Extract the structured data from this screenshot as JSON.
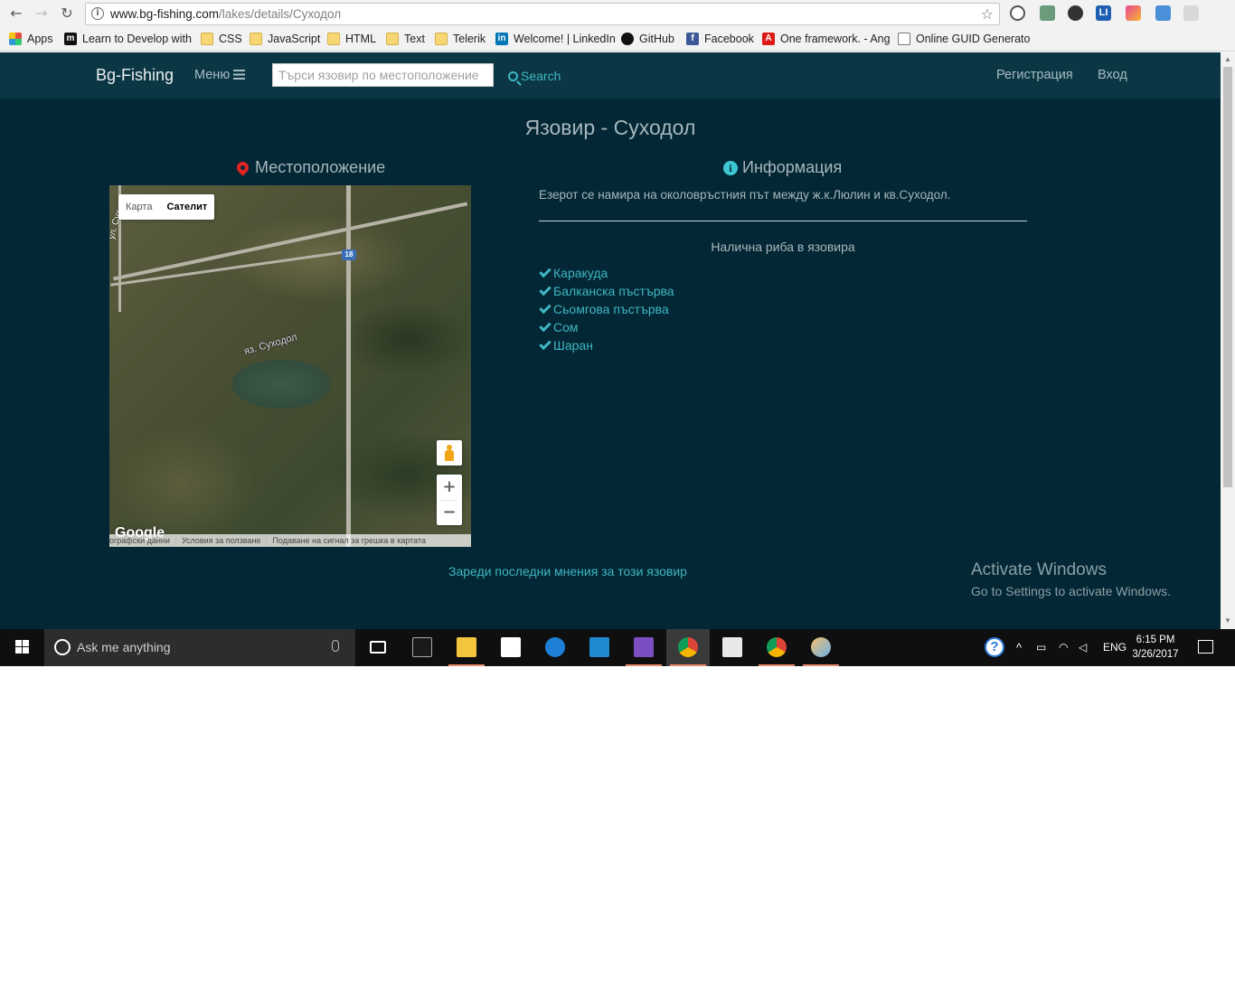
{
  "browser": {
    "url_host": "www.bg-fishing.com",
    "url_path": "/lakes/details/Суходол",
    "bookmarks": [
      {
        "label": "Apps",
        "icon": "apps-grid-icon"
      },
      {
        "label": "Learn to Develop with",
        "icon": "m-icon"
      },
      {
        "label": "CSS",
        "icon": "folder-icon"
      },
      {
        "label": "JavaScript",
        "icon": "folder-icon"
      },
      {
        "label": "HTML",
        "icon": "folder-icon"
      },
      {
        "label": "Text",
        "icon": "folder-icon"
      },
      {
        "label": "Telerik",
        "icon": "folder-icon"
      },
      {
        "label": "Welcome! | LinkedIn",
        "icon": "linkedin-icon"
      },
      {
        "label": "GitHub",
        "icon": "github-icon"
      },
      {
        "label": "Facebook",
        "icon": "facebook-icon"
      },
      {
        "label": "One framework. - Ang",
        "icon": "angular-icon"
      },
      {
        "label": "Online GUID Generato",
        "icon": "page-icon"
      }
    ]
  },
  "navbar": {
    "brand": "Bg-Fishing",
    "menu": "Меню",
    "search_placeholder": "Търси язовир по местоположение",
    "search_button": "Search",
    "register": "Регистрация",
    "login": "Вход"
  },
  "page": {
    "title": "Язовир - Суходол",
    "location_heading": "Местоположение",
    "info_heading": "Информация",
    "info_text": "Езерот се намира на околовръстния път между ж.к.Люлин и кв.Суходол.",
    "fish_heading": "Налична риба в язовира",
    "fish": [
      "Каракуда",
      "Балканска пъстърва",
      "Сьомгова пъстърва",
      "Сом",
      "Шаран"
    ],
    "load_comments": "Зареди последни мнения за този язовир"
  },
  "map": {
    "type_map": "Карта",
    "type_satellite": "Сателит",
    "lake_label": "яз. Суходол",
    "road_label": "ул. Сух",
    "route_number": "18",
    "google": "Google",
    "footer": [
      "ографски данни",
      "Условия за ползване",
      "Подаване на сигнал за грешка в картата"
    ]
  },
  "watermark": {
    "title": "Activate Windows",
    "subtitle": "Go to Settings to activate Windows."
  },
  "taskbar": {
    "search_placeholder": "Ask me anything",
    "language": "ENG",
    "time": "6:15 PM",
    "date": "3/26/2017"
  },
  "colors": {
    "page_bg": "#032734",
    "navbar_bg": "#0b3744",
    "accent": "#3fb6c4",
    "pin": "#e02424"
  }
}
